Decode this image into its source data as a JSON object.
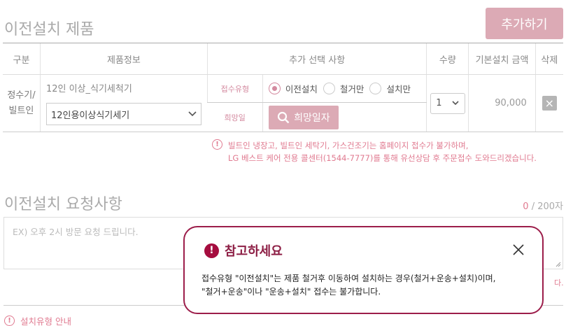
{
  "section1": {
    "title": "이전설치 제품",
    "add_button": "추가하기"
  },
  "table": {
    "headers": [
      "구분",
      "제품정보",
      "추가 선택 사항",
      "수량",
      "기본설치 금액",
      "삭제"
    ],
    "row": {
      "category_line1": "정수기/",
      "category_line2": "빌트인",
      "product_name": "12인 이상_식기세척기",
      "product_select_value": "12인용이상식기세기",
      "option_receipt_label": "접수유형",
      "radio_options": [
        {
          "label": "이전설치",
          "selected": true
        },
        {
          "label": "철거만",
          "selected": false
        },
        {
          "label": "설치만",
          "selected": false
        }
      ],
      "option_date_label": "희망일",
      "date_button_label": "희망일자",
      "quantity": "1",
      "price": "90,000",
      "delete_icon": "×"
    }
  },
  "notice": {
    "icon": "!",
    "line1": "빌트인 냉장고, 빌트인 세탁기, 가스건조기는 홈페이지 접수가 불가하며,",
    "line2": "LG 베스트 케어 전용 콜센터(1544-7777)를 통해 유선상담 후 주문접수 도와드리겠습니다."
  },
  "section2": {
    "title": "이전설치 요청사항",
    "counter_current": "0",
    "counter_max": " / 200자",
    "placeholder": "EX) 오후 2시 방문 요청 드립니다.",
    "trailing_text": "다."
  },
  "install_guide": {
    "label": "설치유형 안내"
  },
  "modal": {
    "title": "참고하세요",
    "line1": "접수유형 \"이전설치\"는 제품 철거후 이동하여 설치하는 경우(철거+운송+설치)이며,",
    "line2": "\"철거+운송\"이나 \"운송+설치\" 접수는 불가합니다."
  },
  "colors": {
    "accent": "#dcaab5",
    "notice": "#e07a90",
    "modal_border": "#9c1d4a"
  }
}
